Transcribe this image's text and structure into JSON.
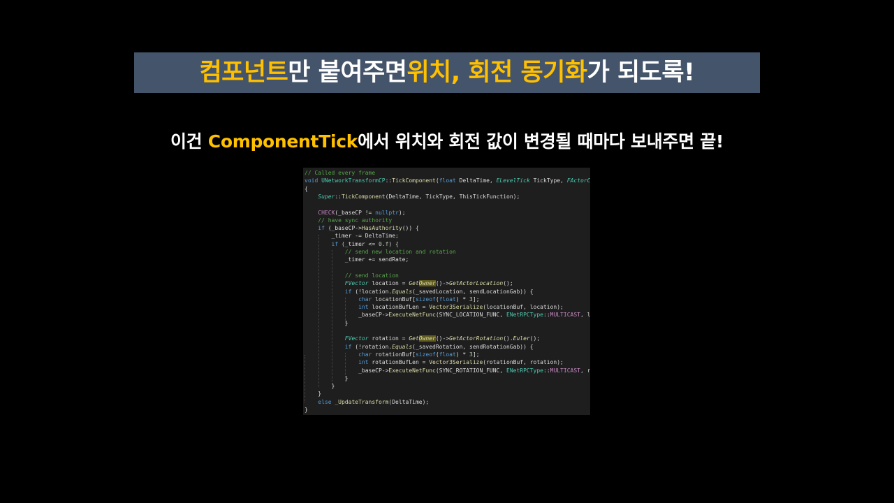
{
  "title": {
    "part1": "컴포넌트",
    "part2": "만 붙여주면 ",
    "part3": "위치, 회전 동기화",
    "part4": "가 되도록!"
  },
  "subtitle": {
    "part1": "이건 ",
    "part2": "ComponentTick",
    "part3": "에서 위치와 회전 값이 변경될 때마다 보내주면 끝!"
  },
  "colors": {
    "background": "#000000",
    "title_box": "#44546a",
    "highlight": "#ffc000",
    "text": "#ffffff",
    "code_background": "#1e1e1e"
  },
  "code": {
    "lines": [
      [
        {
          "t": "// Called every frame",
          "c": "comment"
        }
      ],
      [
        {
          "t": "void ",
          "c": "kw"
        },
        {
          "t": "UNetworkTransformCP",
          "c": "type"
        },
        {
          "t": "::",
          "c": "var"
        },
        {
          "t": "TickComponent",
          "c": "func"
        },
        {
          "t": "(",
          "c": "var"
        },
        {
          "t": "float",
          "c": "kw"
        },
        {
          "t": " DeltaTime, ",
          "c": "var"
        },
        {
          "t": "ELevelTick",
          "c": "typeit"
        },
        {
          "t": " TickType, ",
          "c": "var"
        },
        {
          "t": "FActorComponentTickFunction",
          "c": "typeit"
        }
      ],
      [
        {
          "t": "{",
          "c": "var"
        }
      ],
      [
        {
          "t": "    ",
          "c": "var"
        },
        {
          "t": "Super",
          "c": "typeit"
        },
        {
          "t": "::",
          "c": "var"
        },
        {
          "t": "TickComponent",
          "c": "func"
        },
        {
          "t": "(DeltaTime, TickType, ThisTickFunction);",
          "c": "var"
        }
      ],
      [],
      [
        {
          "t": "    ",
          "c": "var"
        },
        {
          "t": "CHECK",
          "c": "macro"
        },
        {
          "t": "(_baseCP != ",
          "c": "var"
        },
        {
          "t": "nullptr",
          "c": "kw"
        },
        {
          "t": ");",
          "c": "var"
        }
      ],
      [
        {
          "t": "    ",
          "c": "var"
        },
        {
          "t": "// have sync authority",
          "c": "comment"
        }
      ],
      [
        {
          "t": "    ",
          "c": "var"
        },
        {
          "t": "if",
          "c": "kw"
        },
        {
          "t": " (_baseCP->",
          "c": "var"
        },
        {
          "t": "HasAuthority",
          "c": "func"
        },
        {
          "t": "()) {",
          "c": "var"
        }
      ],
      [
        {
          "t": "        _timer -= DeltaTime;",
          "c": "var"
        }
      ],
      [
        {
          "t": "        ",
          "c": "var"
        },
        {
          "t": "if",
          "c": "kw"
        },
        {
          "t": " (_timer <= ",
          "c": "var"
        },
        {
          "t": "0.f",
          "c": "num"
        },
        {
          "t": ") {",
          "c": "var"
        }
      ],
      [
        {
          "t": "            ",
          "c": "var"
        },
        {
          "t": "// send new location and rotation",
          "c": "comment"
        }
      ],
      [
        {
          "t": "            _timer += sendRate;",
          "c": "var"
        }
      ],
      [],
      [
        {
          "t": "            ",
          "c": "var"
        },
        {
          "t": "// send location",
          "c": "comment"
        }
      ],
      [
        {
          "t": "            ",
          "c": "var"
        },
        {
          "t": "FVector",
          "c": "typeit"
        },
        {
          "t": " location = ",
          "c": "var"
        },
        {
          "t": "Get",
          "c": "funcit"
        },
        {
          "t": "Owner",
          "c": "hl"
        },
        {
          "t": "()->",
          "c": "var"
        },
        {
          "t": "GetActorLocation",
          "c": "funcit"
        },
        {
          "t": "();",
          "c": "var"
        }
      ],
      [
        {
          "t": "            ",
          "c": "var"
        },
        {
          "t": "if",
          "c": "kw"
        },
        {
          "t": " (!location.",
          "c": "var"
        },
        {
          "t": "Equals",
          "c": "funcit"
        },
        {
          "t": "(_savedLocation, sendLocationGab)) {",
          "c": "var"
        }
      ],
      [
        {
          "t": "                ",
          "c": "var"
        },
        {
          "t": "char",
          "c": "kw"
        },
        {
          "t": " locationBuf[",
          "c": "var"
        },
        {
          "t": "sizeof",
          "c": "kw"
        },
        {
          "t": "(",
          "c": "var"
        },
        {
          "t": "float",
          "c": "kw"
        },
        {
          "t": ") * ",
          "c": "var"
        },
        {
          "t": "3",
          "c": "num"
        },
        {
          "t": "];",
          "c": "var"
        }
      ],
      [
        {
          "t": "                ",
          "c": "var"
        },
        {
          "t": "int",
          "c": "kw"
        },
        {
          "t": " locationBufLen = ",
          "c": "var"
        },
        {
          "t": "Vector3Serialize",
          "c": "func"
        },
        {
          "t": "(locationBuf, location);",
          "c": "var"
        }
      ],
      [
        {
          "t": "                _baseCP->",
          "c": "var"
        },
        {
          "t": "ExecuteNetFunc",
          "c": "func"
        },
        {
          "t": "(SYNC_LOCATION_FUNC, ",
          "c": "var"
        },
        {
          "t": "ENetRPCType",
          "c": "type"
        },
        {
          "t": "::",
          "c": "var"
        },
        {
          "t": "MULTICAST",
          "c": "macro"
        },
        {
          "t": ", locationBuf, locationBufLen);",
          "c": "var"
        }
      ],
      [
        {
          "t": "            }",
          "c": "var"
        }
      ],
      [],
      [
        {
          "t": "            ",
          "c": "var"
        },
        {
          "t": "FVector",
          "c": "typeit"
        },
        {
          "t": " rotation = ",
          "c": "var"
        },
        {
          "t": "Get",
          "c": "funcit"
        },
        {
          "t": "Owner",
          "c": "hl"
        },
        {
          "t": "()->",
          "c": "var"
        },
        {
          "t": "GetActorRotation",
          "c": "funcit"
        },
        {
          "t": "().",
          "c": "var"
        },
        {
          "t": "Euler",
          "c": "funcit"
        },
        {
          "t": "();",
          "c": "var"
        }
      ],
      [
        {
          "t": "            ",
          "c": "var"
        },
        {
          "t": "if",
          "c": "kw"
        },
        {
          "t": " (!rotation.",
          "c": "var"
        },
        {
          "t": "Equals",
          "c": "funcit"
        },
        {
          "t": "(_savedRotation, sendRotationGab)) {",
          "c": "var"
        }
      ],
      [
        {
          "t": "                ",
          "c": "var"
        },
        {
          "t": "char",
          "c": "kw"
        },
        {
          "t": " rotationBuf[",
          "c": "var"
        },
        {
          "t": "sizeof",
          "c": "kw"
        },
        {
          "t": "(",
          "c": "var"
        },
        {
          "t": "float",
          "c": "kw"
        },
        {
          "t": ") * ",
          "c": "var"
        },
        {
          "t": "3",
          "c": "num"
        },
        {
          "t": "];",
          "c": "var"
        }
      ],
      [
        {
          "t": "                ",
          "c": "var"
        },
        {
          "t": "int",
          "c": "kw"
        },
        {
          "t": " rotationBufLen = ",
          "c": "var"
        },
        {
          "t": "Vector3Serialize",
          "c": "func"
        },
        {
          "t": "(rotationBuf, rotation);",
          "c": "var"
        }
      ],
      [
        {
          "t": "                _baseCP->",
          "c": "var"
        },
        {
          "t": "ExecuteNetFunc",
          "c": "func"
        },
        {
          "t": "(SYNC_ROTATION_FUNC, ",
          "c": "var"
        },
        {
          "t": "ENetRPCType",
          "c": "type"
        },
        {
          "t": "::",
          "c": "var"
        },
        {
          "t": "MULTICAST",
          "c": "macro"
        },
        {
          "t": ", rotationBuf, rotationBufLen);",
          "c": "var"
        }
      ],
      [
        {
          "t": "            }",
          "c": "var"
        }
      ],
      [
        {
          "t": "        }",
          "c": "var"
        }
      ],
      [
        {
          "t": "    }",
          "c": "var"
        }
      ],
      [
        {
          "t": "    ",
          "c": "var"
        },
        {
          "t": "else",
          "c": "kw"
        },
        {
          "t": " ",
          "c": "var"
        },
        {
          "t": "_UpdateTransform",
          "c": "func"
        },
        {
          "t": "(DeltaTime);",
          "c": "var"
        }
      ],
      [
        {
          "t": "}",
          "c": "var"
        }
      ]
    ]
  }
}
